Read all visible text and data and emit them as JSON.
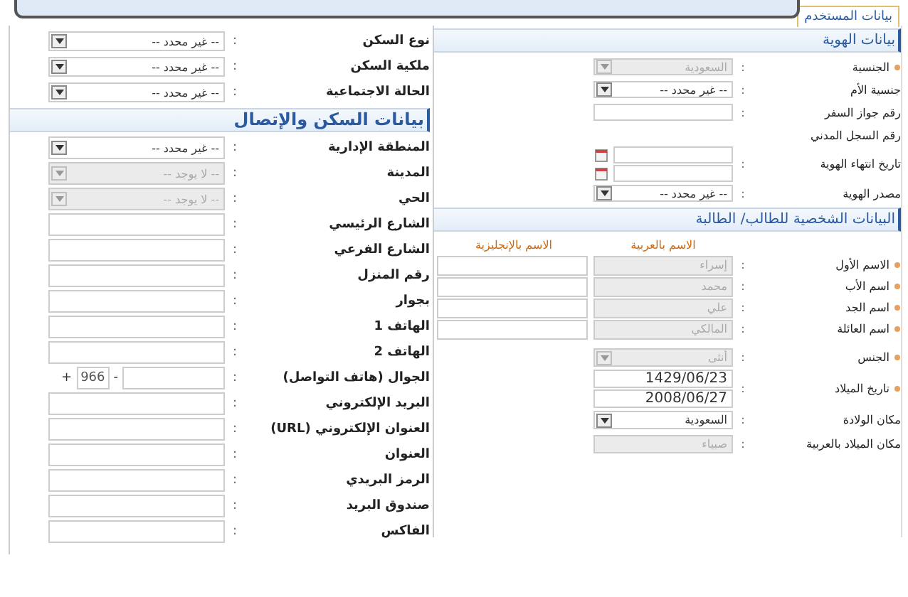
{
  "tab": {
    "label": "بيانات المستخدم",
    "selected": true
  },
  "identity": {
    "title": "بيانات الهوية",
    "rows": [
      {
        "label": "الجنسية",
        "required": true,
        "sep": ":",
        "kind": "select",
        "value": "السعودية",
        "disabled": true
      },
      {
        "label": "جنسية الأم",
        "sep": ":",
        "kind": "select",
        "value": "-- غير محدد --",
        "disabled": false
      },
      {
        "label": "رقم جواز السفر",
        "sep": ":",
        "kind": "text"
      },
      {
        "label": "رقم السجل المدني",
        "kind": "none"
      },
      {
        "label": "تاريخ انتهاء الهوية",
        "sep": ":",
        "kind": "date_pair"
      },
      {
        "label": "مصدر الهوية",
        "sep": ":",
        "kind": "select",
        "value": "-- غير محدد --",
        "disabled": false
      }
    ]
  },
  "personal": {
    "title": "البيانات الشخصية للطالب/ الطالبة",
    "columns": [
      "الاسم بالعربية",
      "الاسم بالإنجليزية"
    ],
    "names": [
      {
        "label": "الاسم الأول",
        "required": true,
        "sep": ":",
        "arabic": "إسراء"
      },
      {
        "label": "اسم الأب",
        "required": true,
        "sep": ":",
        "arabic": "محمد"
      },
      {
        "label": "اسم الجد",
        "required": true,
        "sep": ":",
        "arabic": "علي"
      },
      {
        "label": "اسم العائلة",
        "required": true,
        "sep": ":",
        "arabic": "المالكي"
      }
    ],
    "rows": [
      {
        "label": "الجنس",
        "required": true,
        "sep": ":",
        "kind": "select",
        "value": "أنثى",
        "disabled": true
      },
      {
        "label": "تاريخ الميلاد",
        "required": true,
        "sep": ":",
        "kind": "dual_value",
        "values": [
          "1429/06/23",
          "2008/06/27"
        ]
      },
      {
        "label": "مكان الولادة",
        "sep": ":",
        "kind": "select",
        "value": "السعودية",
        "disabled": false
      },
      {
        "label": "مكان الميلاد بالعربية",
        "sep": ":",
        "kind": "text",
        "value": "صبياء",
        "disabled": true
      }
    ]
  },
  "housing": {
    "top_rows": [
      {
        "label": "نوع السكن",
        "sep": ":",
        "kind": "select",
        "value": "-- غير محدد --",
        "disabled": false
      },
      {
        "label": "ملكية السكن",
        "sep": ":",
        "kind": "select",
        "value": "-- غير محدد --",
        "disabled": false
      },
      {
        "label": "الحالة الاجتماعية",
        "sep": ":",
        "kind": "select",
        "value": "-- غير محدد --",
        "disabled": false
      }
    ],
    "title": "بيانات السكن والإتصال",
    "rows": [
      {
        "label": "المنطقة الإدارية",
        "sep": ":",
        "kind": "select",
        "value": "-- غير محدد --",
        "disabled": false
      },
      {
        "label": "المدينة",
        "sep": ":",
        "kind": "select",
        "value": "-- لا يوجد --",
        "disabled": true
      },
      {
        "label": "الحي",
        "sep": ":",
        "kind": "select",
        "value": "-- لا يوجد --",
        "disabled": true
      },
      {
        "label": "الشارع الرئيسي",
        "sep": ":",
        "kind": "text"
      },
      {
        "label": "الشارع الفرعي",
        "sep": ":",
        "kind": "text"
      },
      {
        "label": "رقم المنزل",
        "sep": ":",
        "kind": "text"
      },
      {
        "label": "بجوار",
        "sep": ":",
        "kind": "text"
      },
      {
        "label": "الهاتف 1",
        "sep": ":",
        "kind": "text"
      },
      {
        "label": "الهاتف 2",
        "sep": ":",
        "kind": "text"
      },
      {
        "label": "الجوال (هاتف التواصل)",
        "sep": ":",
        "kind": "phone",
        "plus": "+",
        "code": "966",
        "dash": "-"
      },
      {
        "label": "البريد الإلكتروني",
        "sep": ":",
        "kind": "text"
      },
      {
        "label": "العنوان الإلكتروني (URL)",
        "sep": ":",
        "kind": "text"
      },
      {
        "label": "العنوان",
        "sep": ":",
        "kind": "text"
      },
      {
        "label": "الرمز البريدي",
        "sep": ":",
        "kind": "text"
      },
      {
        "label": "صندوق البريد",
        "sep": ":",
        "kind": "text"
      },
      {
        "label": "الفاكس",
        "sep": ":",
        "kind": "text"
      }
    ]
  }
}
